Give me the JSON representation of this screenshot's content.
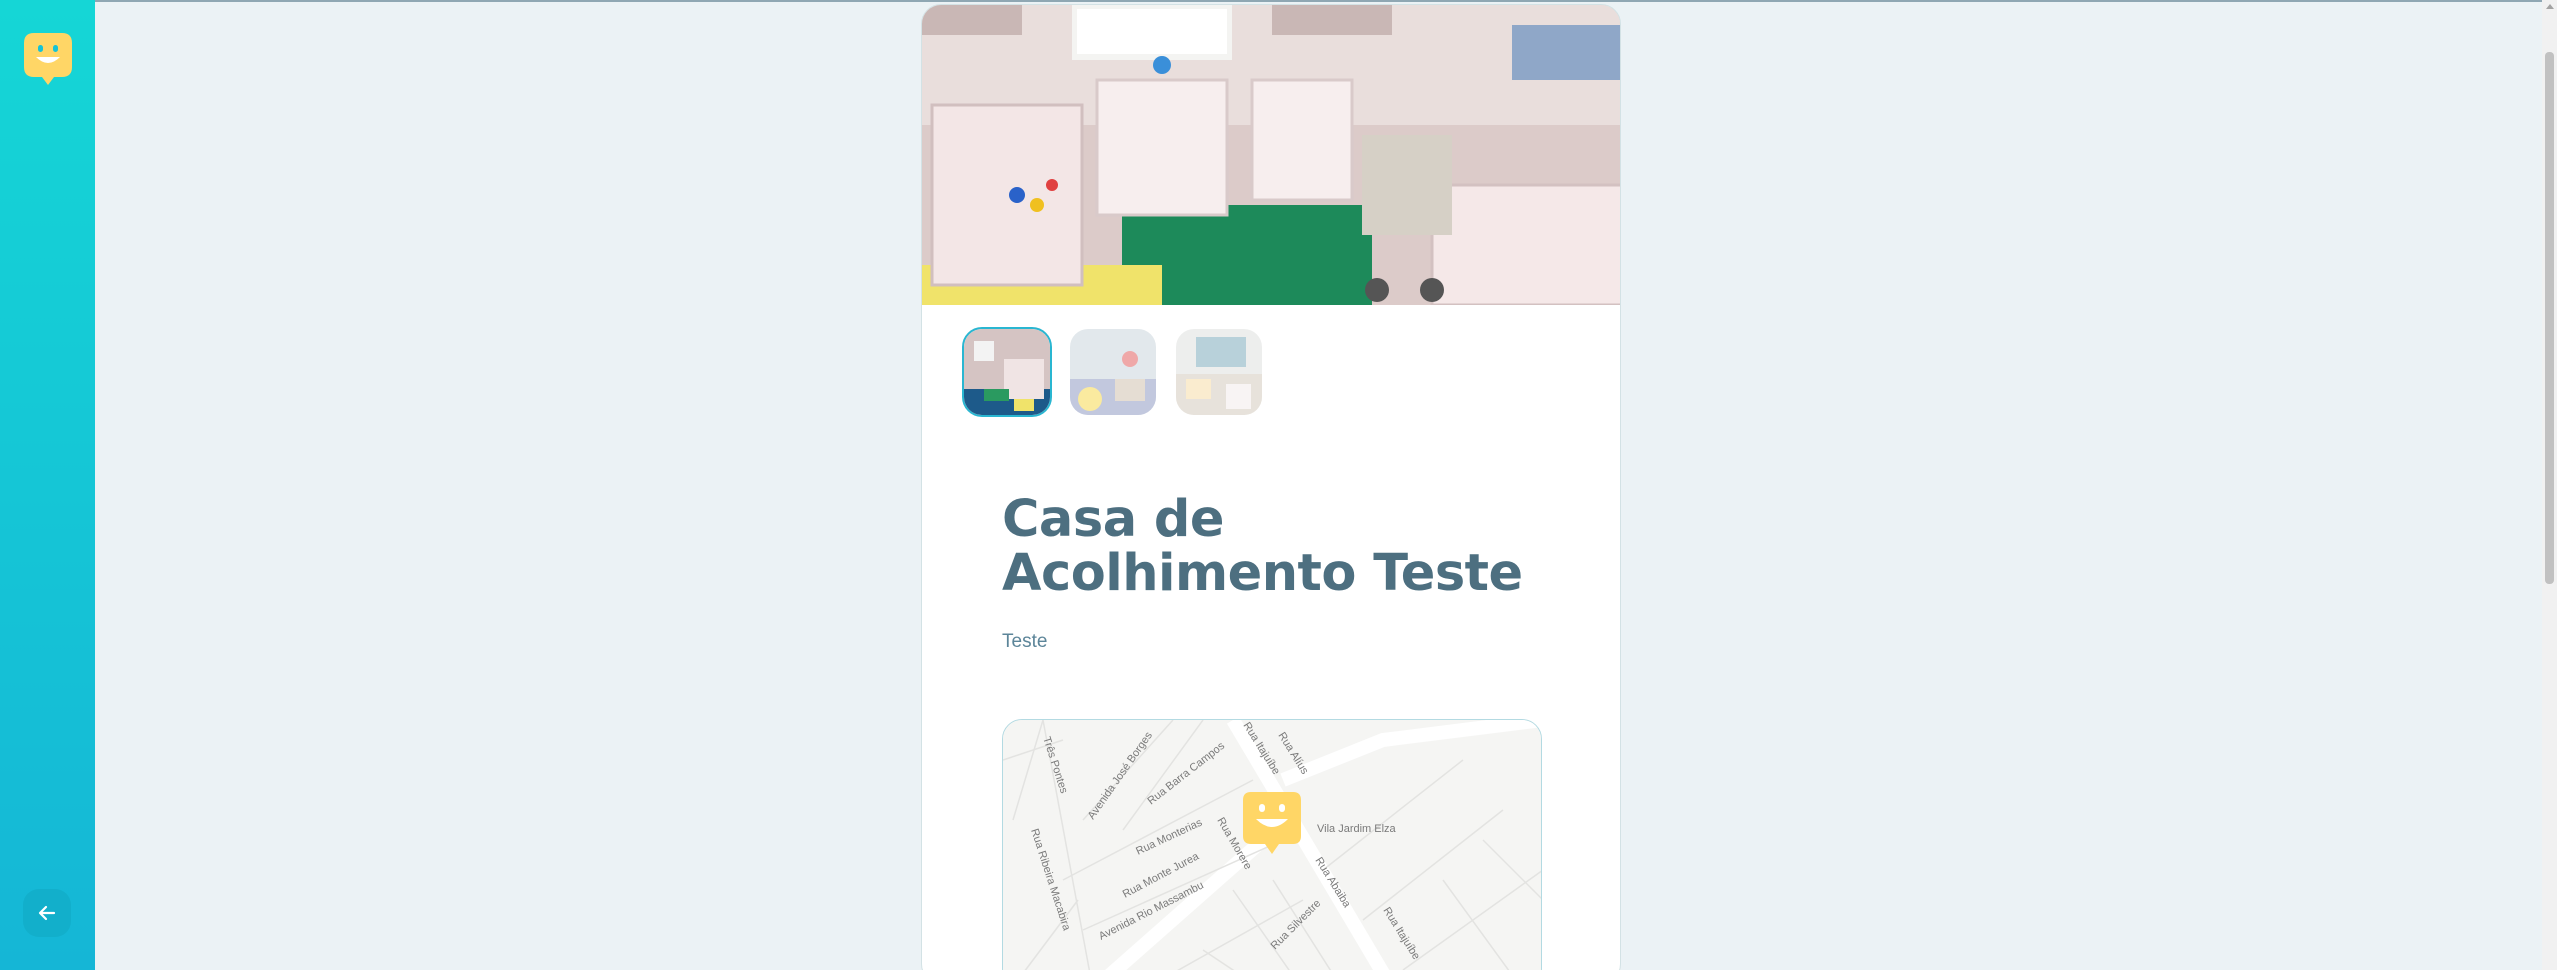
{
  "sidebar": {
    "logo_icon": "happy-balloon-icon",
    "back_icon": "arrow-left-icon"
  },
  "orphanage": {
    "name": "Casa de Acolhimento Teste",
    "about": "Teste",
    "images_count_shown": 3
  },
  "map": {
    "streets": [
      "Três Pontes",
      "Avenida José Borges",
      "Rua Barra Campos",
      "Rua Itajuíbe",
      "Rua Alíus",
      "Rua Monterias",
      "Rua Monte Jurea",
      "Avenida Rio Massambu",
      "Rua Ribeira Macabira",
      "Rua Morere",
      "Rua Abaiba",
      "Rua Itajuíbe",
      "Rua Silvestre",
      "Vila Jardim Elza"
    ],
    "pin_icon": "happy-map-marker-icon"
  },
  "colors": {
    "sidebar_top": "#15d6d6",
    "sidebar_bottom": "#15b6d6",
    "title": "#4d6f80",
    "text": "#5c8599",
    "accent_yellow": "#ffd666"
  }
}
